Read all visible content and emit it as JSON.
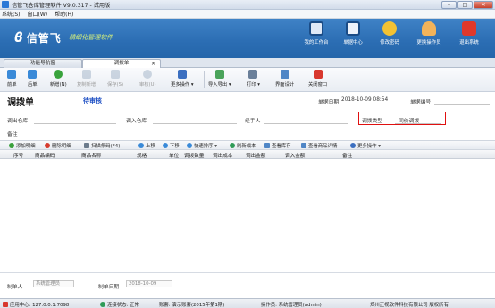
{
  "window": {
    "title": "信管飞仓库管理软件 V9.0.317 - 试用版",
    "min": "–",
    "max": "□",
    "close": "✕"
  },
  "menu": [
    "系统(S)",
    "窗口(W)",
    "帮助(H)"
  ],
  "banner": {
    "logo_mark": "ϐ",
    "brand": "信管飞",
    "tagline": "· 精细化管理软件",
    "nav": [
      {
        "label": "我的工作台",
        "icon": "monitor-icon",
        "color": "#dfe9f7"
      },
      {
        "label": "单据中心",
        "icon": "document-list-icon",
        "color": "#eef3fb"
      },
      {
        "label": "修改密码",
        "icon": "key-lock-icon",
        "color": "#f3c233"
      },
      {
        "label": "更换操作员",
        "icon": "user-icon",
        "color": "#f2b35a"
      },
      {
        "label": "退出系统",
        "icon": "power-icon",
        "color": "#e0382b"
      }
    ]
  },
  "tabs": [
    {
      "label": "功能导航窗"
    },
    {
      "label": "调拨单",
      "close": "×"
    }
  ],
  "toolbar": [
    {
      "label": "前单",
      "icon": "arrow-left-icon",
      "color": "#3a8ad8",
      "enabled": true
    },
    {
      "label": "后单",
      "icon": "arrow-right-icon",
      "color": "#3a8ad8",
      "enabled": true
    },
    {
      "label": "新增(N)",
      "icon": "add-circle-icon",
      "color": "#39a33c",
      "enabled": true
    },
    {
      "label": "复制新增",
      "icon": "copy-icon",
      "color": "#8aa0b8",
      "enabled": false
    },
    {
      "label": "保存(S)",
      "icon": "save-icon",
      "color": "#8aa0b8",
      "enabled": false
    },
    {
      "label": "审核(U)",
      "icon": "approve-icon",
      "color": "#8aa0b8",
      "enabled": false
    },
    {
      "label": "更多操作 ▾",
      "icon": "more-actions-icon",
      "color": "#3b6fc0",
      "enabled": true
    },
    {
      "label": "导入导出 ▾",
      "icon": "import-export-icon",
      "color": "#4aa35a",
      "enabled": true
    },
    {
      "label": "打印 ▾",
      "icon": "print-icon",
      "color": "#6a7f99",
      "enabled": true
    },
    {
      "label": "界面设计",
      "icon": "layout-design-icon",
      "color": "#4f86c6",
      "enabled": true
    },
    {
      "label": "关闭窗口",
      "icon": "close-window-icon",
      "color": "#d8382e",
      "enabled": true
    }
  ],
  "form": {
    "title": "调拨单",
    "status": "待审核",
    "doc_date_label": "单据日期",
    "doc_date": "2018-10-09 08:54",
    "doc_no_label": "单据编号",
    "doc_no": "",
    "out_wh_label": "调出仓库",
    "in_wh_label": "调入仓库",
    "handler_label": "经手人",
    "type_label": "调拨类型",
    "type_value": "同价调拨",
    "remark_label": "备注"
  },
  "detail_toolbar": [
    {
      "label": "添加明细",
      "icon": "add-row-icon",
      "color": "#3aa03c"
    },
    {
      "label": "删除明细",
      "icon": "delete-row-icon",
      "color": "#d63b2e"
    },
    {
      "label": "扫描条码(F4)",
      "icon": "barcode-icon",
      "color": "#6c7b8c"
    },
    {
      "label": "上移",
      "icon": "arrow-up-icon",
      "color": "#3a8ad8"
    },
    {
      "label": "下移",
      "icon": "arrow-down-icon",
      "color": "#3a8ad8"
    },
    {
      "label": "快速排序 ▾",
      "icon": "sort-icon",
      "color": "#3a8ad8"
    },
    {
      "label": "刷新成本",
      "icon": "refresh-icon",
      "color": "#2f9b57"
    },
    {
      "label": "查看库存",
      "icon": "stock-icon",
      "color": "#4f86c6"
    },
    {
      "label": "查看商品详情",
      "icon": "detail-icon",
      "color": "#4f86c6"
    },
    {
      "label": "更多操作 ▾",
      "icon": "more-icon",
      "color": "#3b6fc0"
    }
  ],
  "grid_columns": [
    "序号",
    "商品编码",
    "商品名称",
    "规格",
    "单位",
    "调拨数量",
    "调出成本",
    "调出金额",
    "调入金额",
    "备注"
  ],
  "footer": {
    "maker_label": "制单人",
    "maker": "系统管理员",
    "make_date_label": "制单日期",
    "make_date": "2018-10-09"
  },
  "statusbar": {
    "server": "应用中心: 127.0.0.1:7098",
    "conn": "连接状态: 正常",
    "account": "账套: 演示账套(2015年第1期)",
    "operator": "操作员: 系统管理员(admin)",
    "company": "郑州正视软件科技有限公司 版权所有"
  }
}
